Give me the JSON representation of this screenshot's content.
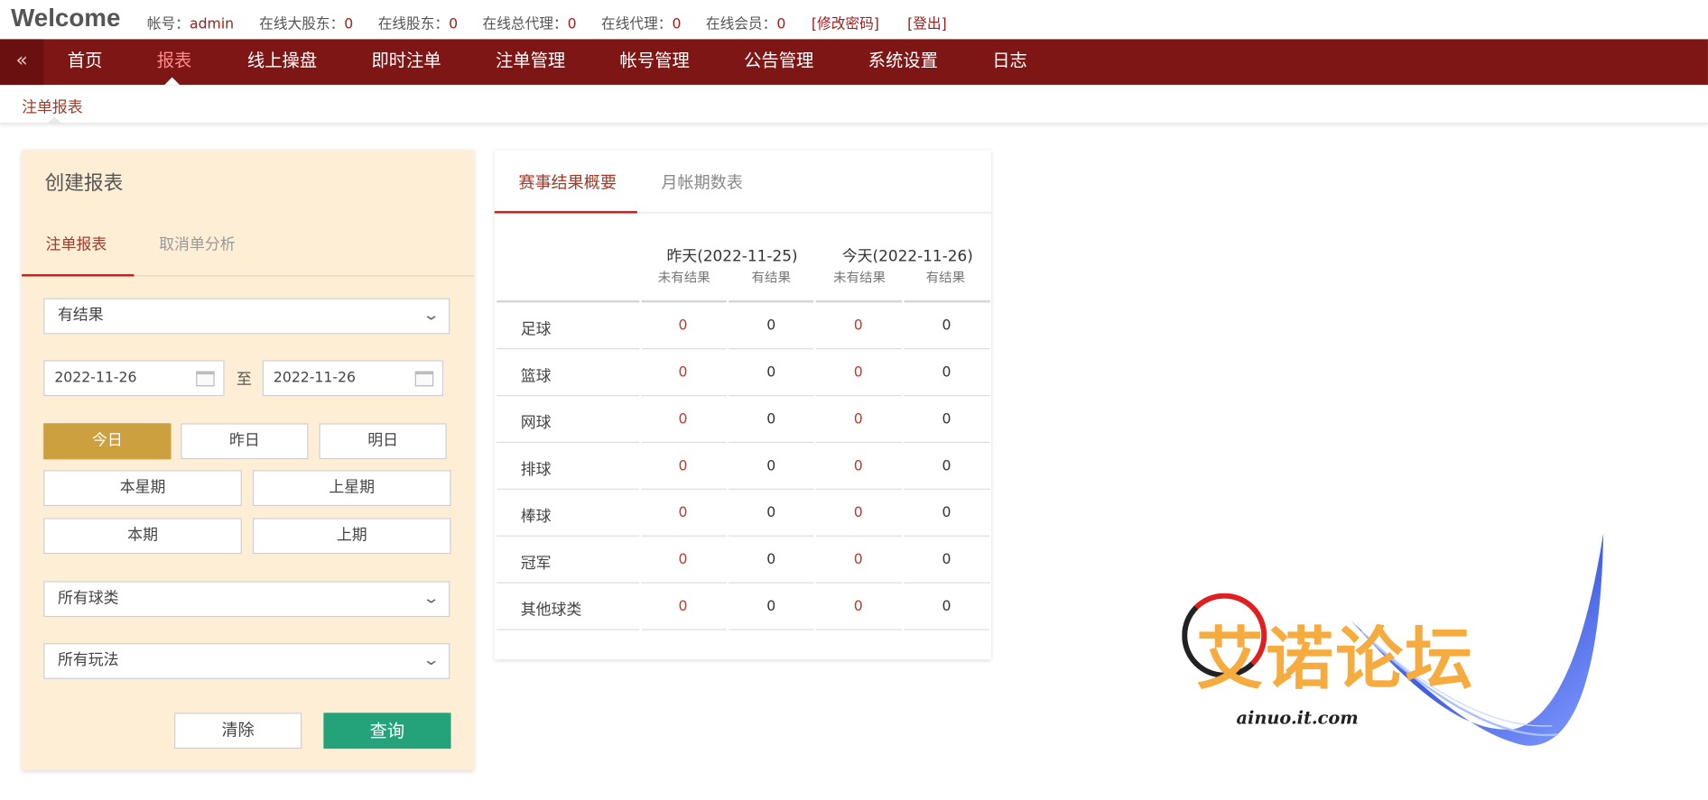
{
  "header": {
    "welcome": "Welcome",
    "account_label": "帐号：",
    "account_value": "admin",
    "online_big_shareholder_label": "在线大股东：",
    "online_big_shareholder_value": "0",
    "online_shareholder_label": "在线股东：",
    "online_shareholder_value": "0",
    "online_general_agent_label": "在线总代理：",
    "online_general_agent_value": "0",
    "online_agent_label": "在线代理：",
    "online_agent_value": "0",
    "online_member_label": "在线会员：",
    "online_member_value": "0",
    "change_password": "[修改密码]",
    "logout": "[登出]"
  },
  "nav": {
    "collapse_icon": "«",
    "items": [
      "首页",
      "报表",
      "线上操盘",
      "即时注单",
      "注单管理",
      "帐号管理",
      "公告管理",
      "系统设置",
      "日志"
    ],
    "active_index": 1
  },
  "breadcrumb": "注单报表",
  "form": {
    "title": "创建报表",
    "tabs": [
      "注单报表",
      "取消单分析"
    ],
    "result_select": "有结果",
    "date_from": "2022-11-26",
    "to_label": "至",
    "date_to": "2022-11-26",
    "quick_buttons": [
      "今日",
      "昨日",
      "明日",
      "本星期",
      "上星期",
      "本期",
      "上期"
    ],
    "sport_select": "所有球类",
    "play_select": "所有玩法",
    "clear_label": "清除",
    "query_label": "查询",
    "chevron": "⌄"
  },
  "summary": {
    "tabs": [
      "赛事结果概要",
      "月帐期数表"
    ],
    "col_groups": [
      "昨天(2022-11-25)",
      "今天(2022-11-26)"
    ],
    "sub_cols": [
      "未有结果",
      "有结果"
    ],
    "rows": [
      {
        "name": "足球",
        "values": [
          "0",
          "0",
          "0",
          "0"
        ]
      },
      {
        "name": "篮球",
        "values": [
          "0",
          "0",
          "0",
          "0"
        ]
      },
      {
        "name": "网球",
        "values": [
          "0",
          "0",
          "0",
          "0"
        ]
      },
      {
        "name": "排球",
        "values": [
          "0",
          "0",
          "0",
          "0"
        ]
      },
      {
        "name": "棒球",
        "values": [
          "0",
          "0",
          "0",
          "0"
        ]
      },
      {
        "name": "冠军",
        "values": [
          "0",
          "0",
          "0",
          "0"
        ]
      },
      {
        "name": "其他球类",
        "values": [
          "0",
          "0",
          "0",
          "0"
        ]
      }
    ]
  },
  "watermark": {
    "logo_text": "艾诺论坛",
    "domain": "ainuo.it.com"
  }
}
